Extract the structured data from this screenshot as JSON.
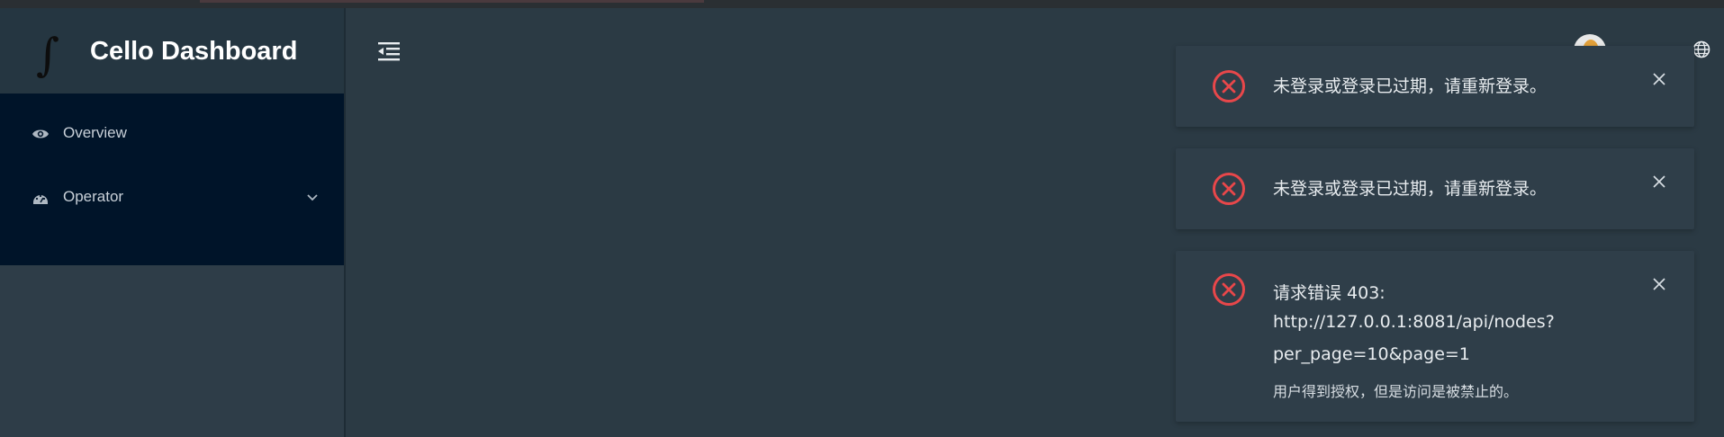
{
  "app": {
    "title": "Cello Dashboard",
    "logo_glyph": "∫"
  },
  "sidebar": {
    "items": [
      {
        "label": "Overview",
        "icon": "eye-icon"
      },
      {
        "label": "Operator",
        "icon": "dashboard-gauge-icon",
        "has_submenu": true
      }
    ]
  },
  "header": {
    "collapse_icon": "menu-fold-icon",
    "avatar_icon": "user-avatar",
    "language_icon": "globe-icon"
  },
  "notifications": [
    {
      "type": "error",
      "icon": "close-circle-icon",
      "message": "未登录或登录已过期，请重新登录。"
    },
    {
      "type": "error",
      "icon": "close-circle-icon",
      "message": "未登录或登录已过期，请重新登录。"
    },
    {
      "type": "error",
      "icon": "close-circle-icon",
      "title_line1": "请求错误 403:",
      "title_line2": "http://127.0.0.1:8081/api/nodes?",
      "title_line3": "per_page=10&page=1",
      "description": "用户得到授权，但是访问是被禁止的。"
    }
  ],
  "colors": {
    "sidebar_menu_bg": "#001429",
    "content_bg": "#2b3a44",
    "error_red": "#e8474a",
    "text_primary": "#e8ecef"
  }
}
